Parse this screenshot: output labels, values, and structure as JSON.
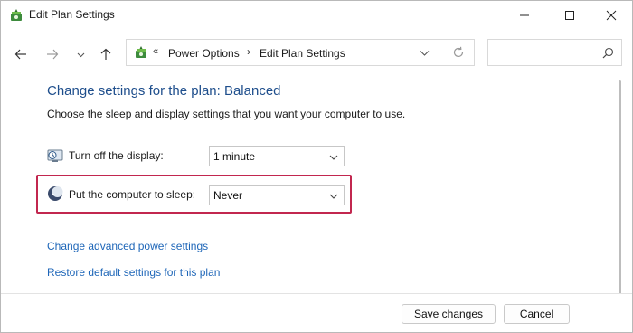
{
  "window": {
    "title": "Edit Plan Settings"
  },
  "address": {
    "crumbs": [
      "Power Options",
      "Edit Plan Settings"
    ]
  },
  "search": {
    "placeholder": ""
  },
  "content": {
    "heading": "Change settings for the plan: Balanced",
    "description": "Choose the sleep and display settings that you want your computer to use.",
    "display_label": "Turn off the display:",
    "display_value": "1 minute",
    "sleep_label": "Put the computer to sleep:",
    "sleep_value": "Never",
    "link_advanced": "Change advanced power settings",
    "link_restore": "Restore default settings for this plan"
  },
  "footer": {
    "save_label": "Save changes",
    "cancel_label": "Cancel"
  },
  "colors": {
    "heading": "#1e4e8c",
    "link": "#1e66b8",
    "highlight": "#c2274f"
  },
  "icons": [
    "power-options-icon",
    "back-arrow-icon",
    "forward-arrow-icon",
    "chevron-down-icon",
    "up-arrow-icon",
    "refresh-icon",
    "search-icon",
    "display-clock-icon",
    "sleep-moon-icon",
    "minimize-icon",
    "maximize-icon",
    "close-icon"
  ]
}
